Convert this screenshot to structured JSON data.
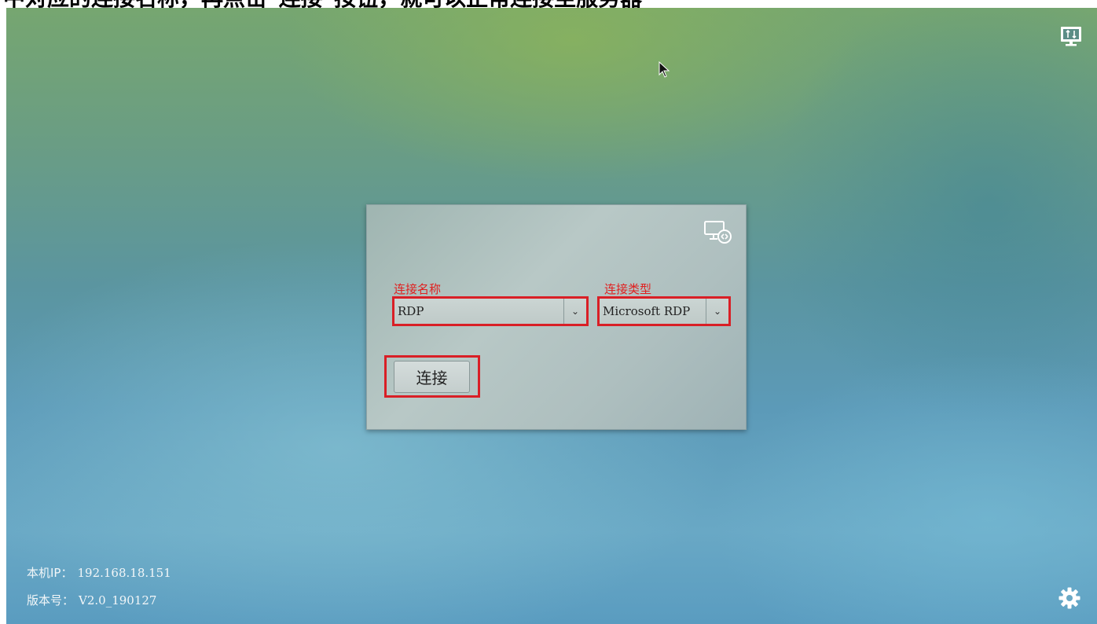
{
  "caption": "中对应的连接名称，再点击\"连接\"按钮，就可以正常连接至服务器",
  "panel": {
    "name_label": "连接名称",
    "type_label": "连接类型",
    "connection_name": "RDP",
    "connection_type": "Microsoft RDP",
    "connect_button": "连接"
  },
  "footer": {
    "ip_label": "本机IP：",
    "ip_value": "192.168.18.151",
    "version_label": "版本号：",
    "version_value": "V2.0_190127"
  },
  "colors": {
    "highlight": "#d91f26",
    "label_red": "#e02020"
  },
  "icons": {
    "top_right": "monitor-transfer-icon",
    "panel": "remote-desktop-icon",
    "bottom_right": "gear-icon"
  }
}
